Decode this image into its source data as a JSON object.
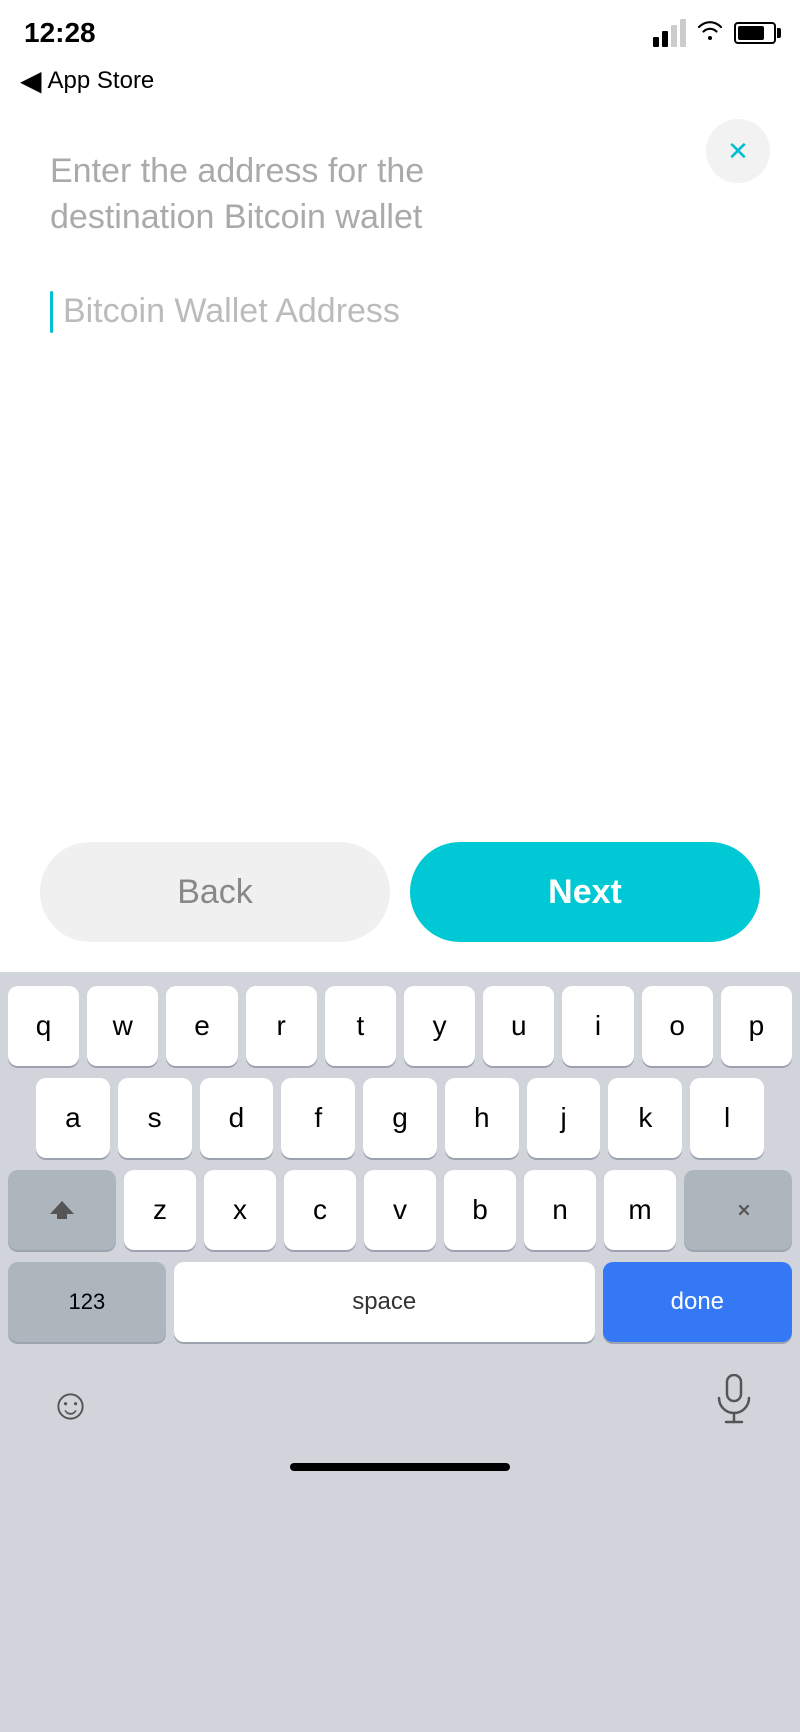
{
  "statusBar": {
    "time": "12:28",
    "navigation_icon": "◀",
    "back_label": "App Store"
  },
  "closeButton": {
    "label": "✕"
  },
  "form": {
    "description": "Enter the address for the destination Bitcoin wallet",
    "input_placeholder": "Bitcoin Wallet Address",
    "input_value": ""
  },
  "buttons": {
    "back_label": "Back",
    "next_label": "Next"
  },
  "keyboard": {
    "row1": [
      "q",
      "w",
      "e",
      "r",
      "t",
      "y",
      "u",
      "i",
      "o",
      "p"
    ],
    "row2": [
      "a",
      "s",
      "d",
      "f",
      "g",
      "h",
      "j",
      "k",
      "l"
    ],
    "row3": [
      "z",
      "x",
      "c",
      "v",
      "b",
      "n",
      "m"
    ],
    "space_label": "space",
    "done_label": "done",
    "num_label": "123",
    "delete_symbol": "⌫"
  }
}
